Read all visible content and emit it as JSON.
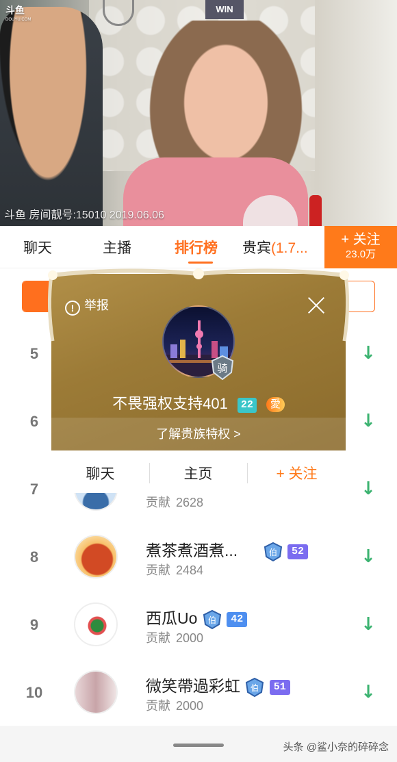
{
  "video": {
    "logo_text": "斗鱼",
    "logo_sub": "DOUYU.COM",
    "sign_text": "WIN",
    "watermark": "斗鱼 房间靓号:15010 2019.06.06"
  },
  "tabs": {
    "chat": "聊天",
    "streamer": "主播",
    "ranking": "排行榜",
    "vip": "贵宾",
    "vip_count": "(1.7..."
  },
  "follow_button": {
    "label": "+ 关注",
    "count": "23.0万"
  },
  "popup": {
    "report_label": "举报",
    "username": "不畏强权支持401",
    "level": "22",
    "love_badge": "愛",
    "knight_badge": "骑",
    "privilege_link": "了解贵族特权 >",
    "actions": {
      "chat": "聊天",
      "homepage": "主页",
      "follow": "+ 关注"
    }
  },
  "ranking": {
    "contrib_label": "贡献",
    "rows": [
      {
        "rank": "5"
      },
      {
        "rank": "6"
      },
      {
        "rank": "7",
        "contribution": "2628"
      },
      {
        "rank": "8",
        "name": "煮茶煮酒煮...",
        "noble": "伯",
        "level": "52",
        "contribution": "2484"
      },
      {
        "rank": "9",
        "name": "西瓜Uo",
        "noble": "伯",
        "level": "42",
        "contribution": "2000"
      },
      {
        "rank": "10",
        "name": "微笑帶過彩虹",
        "noble": "伯",
        "level": "51",
        "contribution": "2000"
      }
    ]
  },
  "footer": {
    "credit": "头条 @鲨小奈的碎碎念"
  },
  "colors": {
    "accent": "#ff6f1e",
    "popup_gold": "#9c7b37",
    "arrow_green": "#3cb371",
    "level_purple": "#7b6cf0",
    "level_blue": "#4e8ff0"
  }
}
